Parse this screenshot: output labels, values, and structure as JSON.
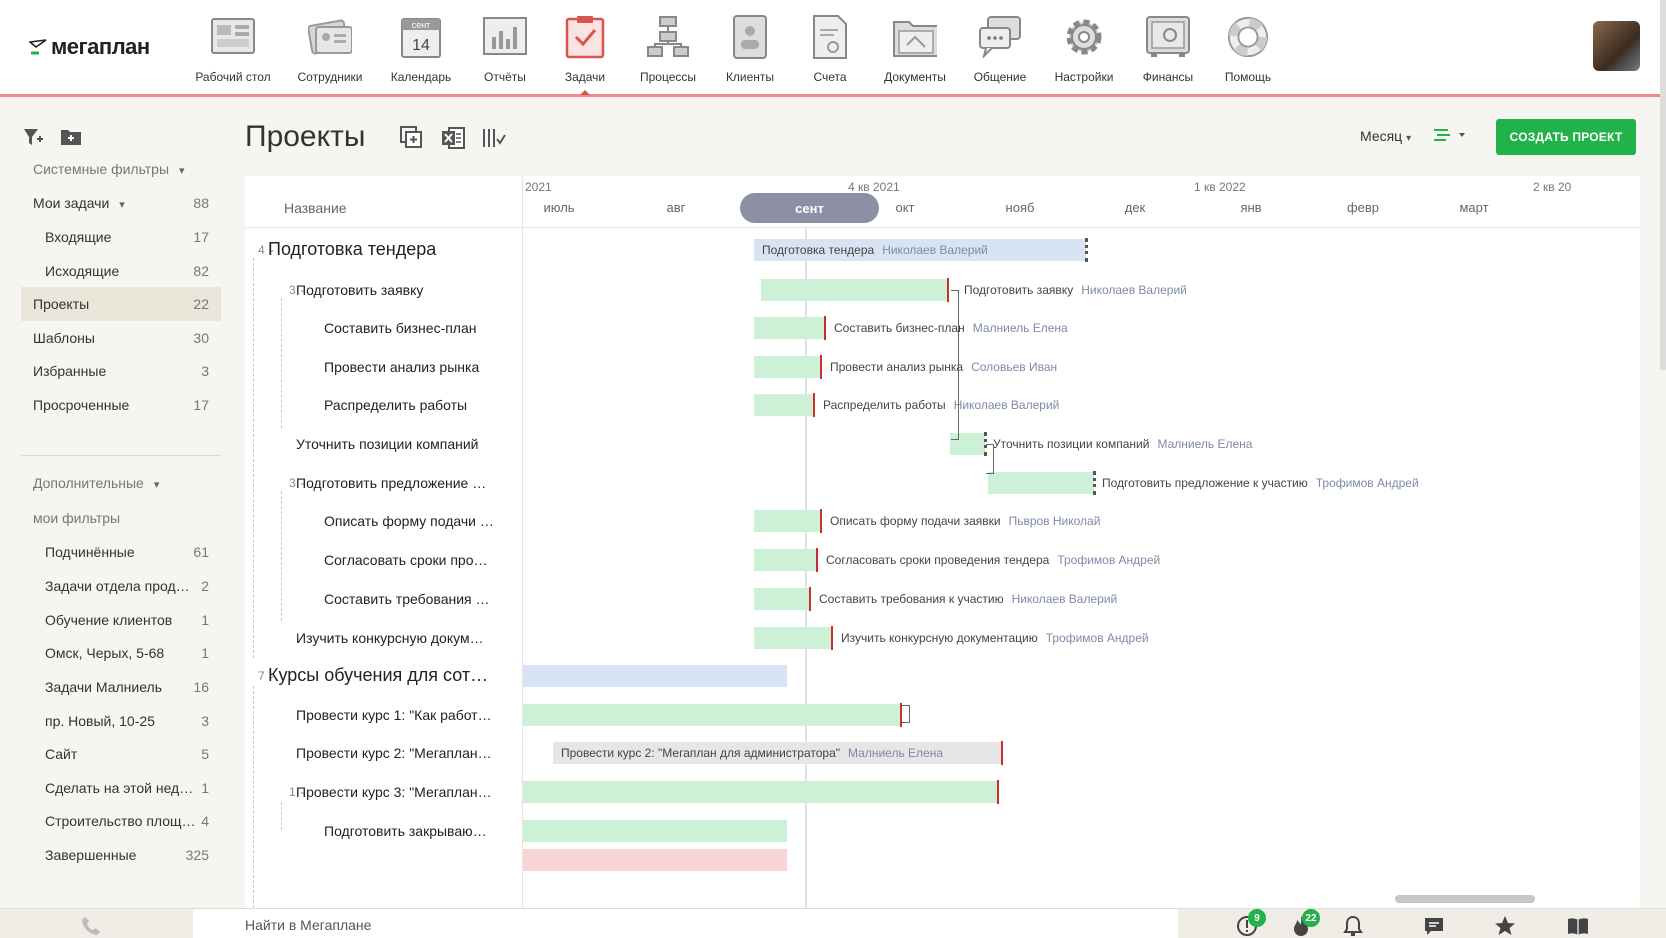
{
  "app": {
    "logo": "мегаплан"
  },
  "nav": [
    {
      "label": "Рабочий стол",
      "icon": "desktop-icon"
    },
    {
      "label": "Сотрудники",
      "icon": "employees-icon"
    },
    {
      "label": "Календарь",
      "icon": "calendar-icon",
      "cal_month": "сент",
      "cal_day": "14"
    },
    {
      "label": "Отчёты",
      "icon": "reports-icon"
    },
    {
      "label": "Задачи",
      "icon": "tasks-icon",
      "active": true
    },
    {
      "label": "Процессы",
      "icon": "processes-icon"
    },
    {
      "label": "Клиенты",
      "icon": "clients-icon"
    },
    {
      "label": "Счета",
      "icon": "invoices-icon"
    },
    {
      "label": "Документы",
      "icon": "documents-icon"
    },
    {
      "label": "Общение",
      "icon": "chat-icon"
    },
    {
      "label": "Настройки",
      "icon": "settings-icon"
    },
    {
      "label": "Финансы",
      "icon": "finance-icon"
    },
    {
      "label": "Помощь",
      "icon": "help-icon"
    }
  ],
  "sidebar": {
    "system_filters": "Системные фильтры",
    "my_tasks": {
      "label": "Мои задачи",
      "count": "88"
    },
    "incoming": {
      "label": "Входящие",
      "count": "17"
    },
    "outgoing": {
      "label": "Исходящие",
      "count": "82"
    },
    "projects": {
      "label": "Проекты",
      "count": "22"
    },
    "templates": {
      "label": "Шаблоны",
      "count": "30"
    },
    "favorites": {
      "label": "Избранные",
      "count": "3"
    },
    "overdue": {
      "label": "Просроченные",
      "count": "17"
    },
    "extra": "Дополнительные",
    "my_filters": "мои фильтры",
    "filters": [
      {
        "label": "Подчинённые",
        "count": "61"
      },
      {
        "label": "Задачи отдела прод…",
        "count": "2"
      },
      {
        "label": "Обучение клиентов",
        "count": "1"
      },
      {
        "label": "Омск, Черых, 5-68",
        "count": "1"
      },
      {
        "label": "Задачи Малниель",
        "count": "16"
      },
      {
        "label": "пр. Новый, 10-25",
        "count": "3"
      },
      {
        "label": "Сайт",
        "count": "5"
      },
      {
        "label": "Сделать на этой нед…",
        "count": "1"
      },
      {
        "label": "Строительство площ…",
        "count": "4"
      },
      {
        "label": "Завершенные",
        "count": "325"
      }
    ]
  },
  "header": {
    "title": "Проекты",
    "period": "Месяц",
    "create_button": "СОЗДАТЬ ПРОЕКТ"
  },
  "gantt": {
    "name_col": "Название",
    "quarters": [
      {
        "label": "2021"
      },
      {
        "label": "4 кв 2021"
      },
      {
        "label": "1 кв 2022"
      },
      {
        "label": "2 кв 20"
      }
    ],
    "months": [
      "июль",
      "авг",
      "сент",
      "окт",
      "нояб",
      "дек",
      "янв",
      "февр",
      "март"
    ],
    "active_month": "сент",
    "rows": [
      {
        "num": "4",
        "name": "Подготовка тендера",
        "bar_label": "Подготовка тендера",
        "resp": "Николаев Валерий"
      },
      {
        "num": "3",
        "name": "Подготовить заявку",
        "bar_label": "Подготовить заявку",
        "resp": "Николаев Валерий"
      },
      {
        "num": "",
        "name": "Составить бизнес-план",
        "bar_label": "Составить бизнес-план",
        "resp": "Малниель Елена"
      },
      {
        "num": "",
        "name": "Провести анализ рынка",
        "bar_label": "Провести анализ рынка",
        "resp": "Соловьев Иван"
      },
      {
        "num": "",
        "name": "Распределить работы",
        "bar_label": "Распределить работы",
        "resp": "Николаев Валерий"
      },
      {
        "num": "",
        "name": "Уточнить позиции компаний",
        "bar_label": "Уточнить позиции компаний",
        "resp": "Малниель Елена"
      },
      {
        "num": "3",
        "name": "Подготовить предложение …",
        "bar_label": "Подготовить предложение к участию",
        "resp": "Трофимов Андрей"
      },
      {
        "num": "",
        "name": "Описать форму подачи …",
        "bar_label": "Описать форму подачи заявки",
        "resp": "Пьвров Николай"
      },
      {
        "num": "",
        "name": "Согласовать сроки про…",
        "bar_label": "Согласовать сроки проведения тендера",
        "resp": "Трофимов Андрей"
      },
      {
        "num": "",
        "name": "Составить требования …",
        "bar_label": "Составить требования к участию",
        "resp": "Николаев Валерий"
      },
      {
        "num": "",
        "name": "Изучить конкурсную докум…",
        "bar_label": "Изучить конкурсную документацию",
        "resp": "Трофимов Андрей"
      },
      {
        "num": "7",
        "name": "Курсы обучения для сотр…",
        "bar_label": "",
        "resp": ""
      },
      {
        "num": "",
        "name": "Провести курс 1: \"Как работ…",
        "bar_label": "",
        "resp": ""
      },
      {
        "num": "",
        "name": "Провести курс 2: \"Мегаплан…",
        "bar_label": "Провести курс 2: \"Мегаплан для администратора\"",
        "resp": "Малниель Елена"
      },
      {
        "num": "1",
        "name": "Провести курс 3: \"Мегаплан…",
        "bar_label": "",
        "resp": ""
      },
      {
        "num": "",
        "name": "Подготовить закрываю…",
        "bar_label": "",
        "resp": ""
      }
    ]
  },
  "bottom": {
    "search_placeholder": "Найти в Мегаплане",
    "alerts_badge": "9",
    "fire_badge": "22"
  },
  "colors": {
    "accent": "#21b249",
    "nav_border": "#ef8a8d",
    "bar_green": "#ccf1d6",
    "bar_blue": "#d8e4f3",
    "deadline": "#c9302c",
    "month_active": "#8d8fa5"
  }
}
